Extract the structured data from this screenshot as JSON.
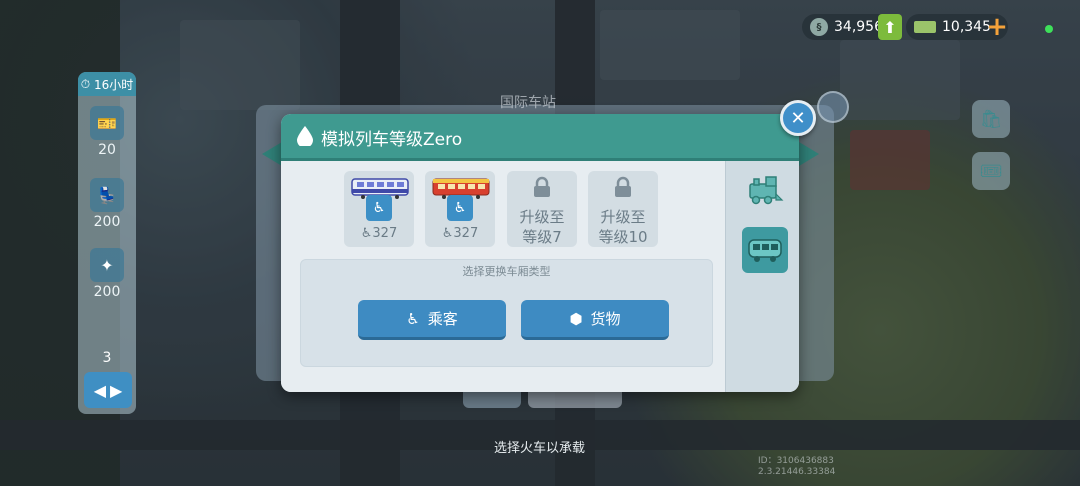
{
  "hud": {
    "simoleons": "34,956",
    "simcash": "10,345",
    "simoleon_icon": "simoleon-coin-icon",
    "simcash_icon": "simcash-bill-icon"
  },
  "left_panel": {
    "timer": "16小时",
    "items": [
      {
        "icon": "train-ticket-icon",
        "value": "20"
      },
      {
        "icon": "passenger-seat-icon",
        "value": "200"
      },
      {
        "icon": "passenger-upgrade-icon",
        "value": "200"
      }
    ],
    "count": "3"
  },
  "background": {
    "panel_title": "国际车站",
    "hint": "选择火车以承载",
    "id_line1": "ID：3106436883",
    "id_line2": "2.3.21446.33384"
  },
  "dialog": {
    "title": "模拟列车等级Zero",
    "cars": [
      {
        "type": "passenger-car",
        "capacity": "327",
        "colors": {
          "body": "#e8eef7",
          "stripe": "#3f49a8"
        }
      },
      {
        "type": "passenger-car",
        "capacity": "327",
        "colors": {
          "body": "#d8402f",
          "stripe": "#f4c443"
        }
      }
    ],
    "locked": [
      {
        "line1": "升级至",
        "line2": "等级7"
      },
      {
        "line1": "升级至",
        "line2": "等级10"
      }
    ],
    "choose_label": "选择更换车厢类型",
    "btn_passenger": "乘客",
    "btn_cargo": "货物",
    "tabs": [
      "locomotive-icon",
      "train-car-icon"
    ],
    "accent": "#3f9a90",
    "button_color": "#3e8bc2"
  }
}
